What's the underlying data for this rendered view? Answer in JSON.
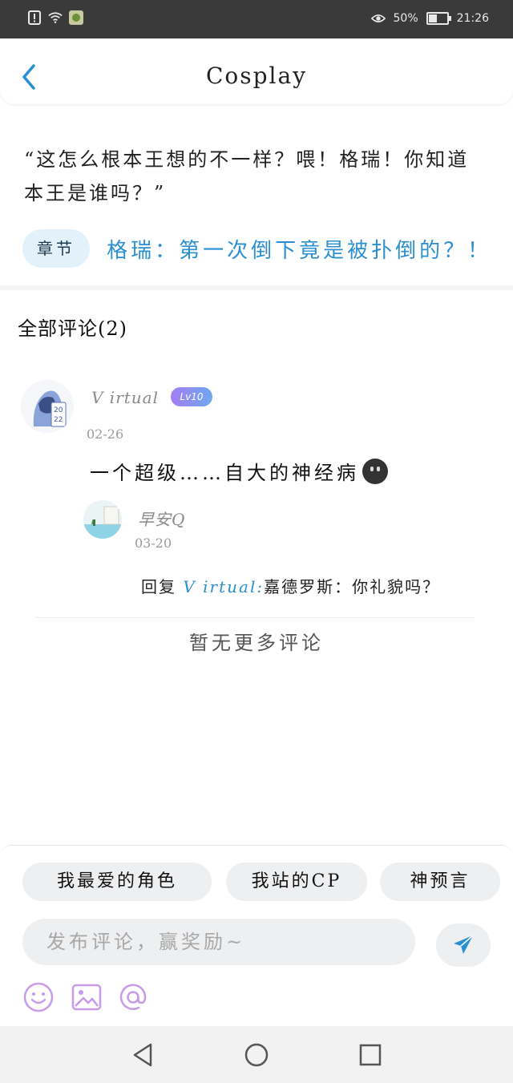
{
  "status_bar": {
    "battery": "50%",
    "time": "21:26"
  },
  "header": {
    "title": "Cosplay"
  },
  "quote": "“这怎么根本王想的不一样？喂！格瑞！你知道本王是谁吗？”",
  "chapter": {
    "tag": "章节",
    "title": "格瑞：第一次倒下竟是被扑倒的？！"
  },
  "comments": {
    "title": "全部评论(2)",
    "items": [
      {
        "user": "V irtual",
        "level": "Lv10",
        "date": "02-26",
        "text": "一个超级……自大的神经病"
      }
    ],
    "reply": {
      "user": "早安Q",
      "date": "03-20",
      "prefix": "回复",
      "mention": "V irtual:",
      "text": "嘉德罗斯：你礼貌吗？"
    },
    "no_more": "暂无更多评论"
  },
  "quick_tags": [
    "我最爱的角色",
    "我站的CP",
    "神预言"
  ],
  "input": {
    "placeholder": "发布评论，赢奖励~"
  },
  "colors": {
    "accent": "#2a8fd1",
    "badge_start": "#a47ef2",
    "badge_end": "#6fa8ef",
    "tool_icon": "#c79be8"
  }
}
